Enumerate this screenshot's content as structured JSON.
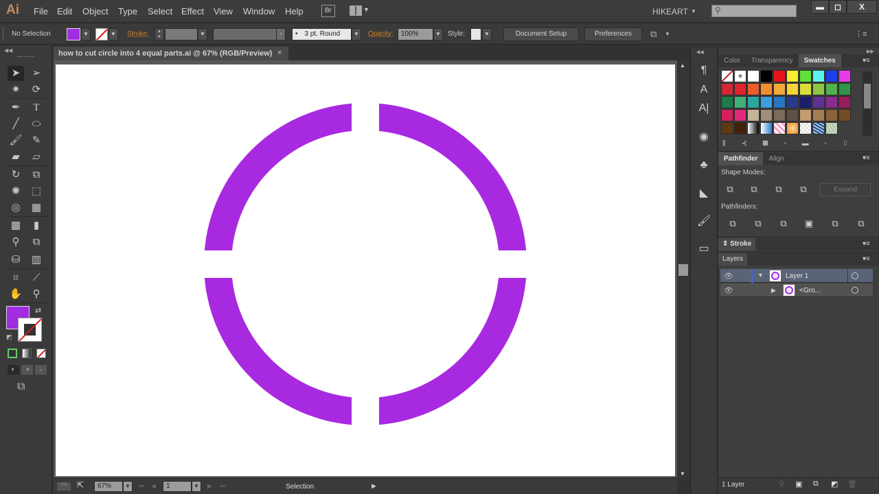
{
  "app": {
    "logo": "Ai",
    "menus": [
      "File",
      "Edit",
      "Object",
      "Type",
      "Select",
      "Effect",
      "View",
      "Window",
      "Help"
    ],
    "bridge_label": "Br",
    "workspace": "HIKEART",
    "search_placeholder": "",
    "window_controls": {
      "minimize": "‒",
      "maximize": "□",
      "close": "X"
    }
  },
  "control_bar": {
    "selection_status": "No Selection",
    "fill_color": "#a12ce0",
    "stroke_label": "Stroke:",
    "stroke_weight": "",
    "brush_profile": "",
    "brush_label": "3 pt. Round",
    "opacity_label": "Opacity:",
    "opacity_value": "100%",
    "style_label": "Style:",
    "document_setup": "Document Setup",
    "preferences": "Preferences"
  },
  "document": {
    "tab_title": "how to cut circle into 4 equal parts.ai @ 67% (RGB/Preview)",
    "close": "×",
    "artwork": {
      "description": "circle cut into 4 equal ring segments",
      "color": "#a82ae0",
      "segments": 4
    }
  },
  "status_bar": {
    "zoom": "67%",
    "artboard": "1",
    "tool": "Selection"
  },
  "tools": {
    "fill_color": "#a12ce0",
    "stroke": "none"
  },
  "swatches_panel": {
    "tabs": [
      "Color",
      "Transparency",
      "Swatches"
    ],
    "active_tab": "Swatches",
    "rows": [
      [
        "none",
        "registration",
        "#ffffff",
        "#000000",
        "#e8141c",
        "#f9ed32",
        "#5ee238",
        "#5ff0f0",
        "#1c3fe8",
        "#e53ce8"
      ],
      [
        "#d12a34",
        "#e0232f",
        "#e95c2a",
        "#ef8f30",
        "#f2a83a",
        "#f5d43a",
        "#d9de3b",
        "#8ec643",
        "#4fb24a",
        "#2e9747"
      ],
      [
        "#1f7a49",
        "#3fb07a",
        "#2aa5a0",
        "#3b9ee0",
        "#2877c4",
        "#2b3990",
        "#1b1d6e",
        "#62309a",
        "#8a2b8f",
        "#9b1c5c"
      ],
      [
        "#d41e5e",
        "#e0297a",
        "#c6b39a",
        "#a08e7a",
        "#7d6a59",
        "#5e4f44",
        "#c49c6f",
        "#a67c52",
        "#8b6239",
        "#754c24"
      ],
      [
        "#603813",
        "#42210b",
        "gradient-bw",
        "gradient-blue",
        "pattern-pink",
        "gradient-orange",
        "pattern-checker",
        "pattern-blue",
        "pattern-yellow"
      ]
    ]
  },
  "pathfinder_panel": {
    "tabs": [
      "Pathfinder",
      "Align"
    ],
    "active_tab": "Pathfinder",
    "shape_modes_label": "Shape Modes:",
    "pathfinders_label": "Pathfinders:",
    "expand": "Expand"
  },
  "stroke_panel": {
    "title": "Stroke"
  },
  "layers_panel": {
    "title": "Layers",
    "layers": [
      {
        "name": "Layer 1",
        "expanded": true
      },
      {
        "name": "<Gro...",
        "expanded": false
      }
    ],
    "footer": "1 Layer"
  }
}
